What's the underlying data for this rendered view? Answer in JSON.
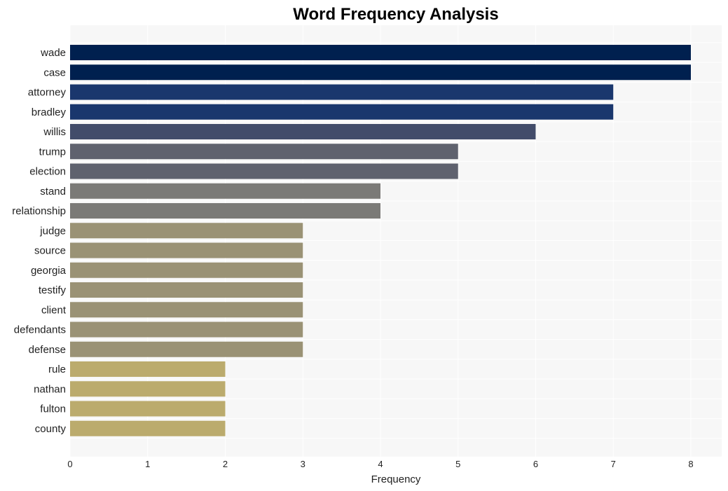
{
  "chart_data": {
    "type": "bar",
    "orientation": "horizontal",
    "title": "Word Frequency Analysis",
    "xlabel": "Frequency",
    "ylabel": "",
    "xlim": [
      0,
      8.4
    ],
    "xticks": [
      0,
      1,
      2,
      3,
      4,
      5,
      6,
      7,
      8
    ],
    "grid": true,
    "legend": "none",
    "categories": [
      "wade",
      "case",
      "attorney",
      "bradley",
      "willis",
      "trump",
      "election",
      "stand",
      "relationship",
      "judge",
      "source",
      "georgia",
      "testify",
      "client",
      "defendants",
      "defense",
      "rule",
      "nathan",
      "fulton",
      "county"
    ],
    "values": [
      8,
      8,
      7,
      7,
      6,
      5,
      5,
      4,
      4,
      3,
      3,
      3,
      3,
      3,
      3,
      3,
      2,
      2,
      2,
      2
    ],
    "colors_by_value": {
      "8": "#00204f",
      "7": "#1a376d",
      "6": "#424c6a",
      "5": "#5f626e",
      "4": "#7b7a77",
      "3": "#9a9275",
      "2": "#bbab6d"
    },
    "plot_background": "#f7f7f7"
  }
}
